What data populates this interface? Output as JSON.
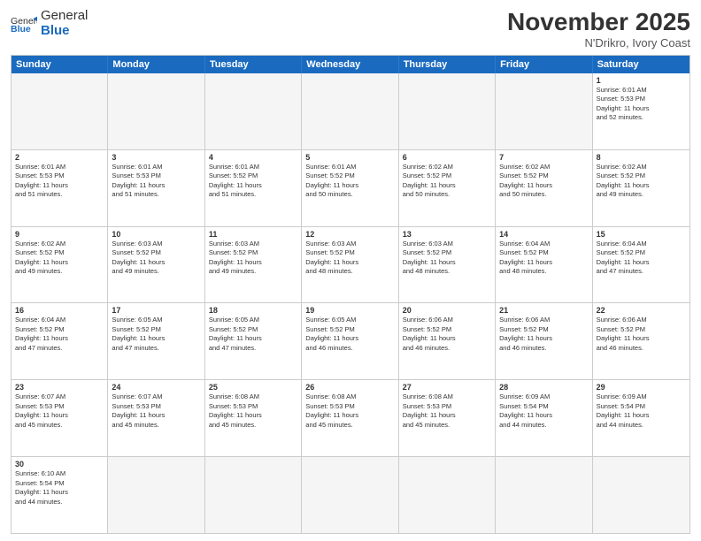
{
  "header": {
    "logo_general": "General",
    "logo_blue": "Blue",
    "month_title": "November 2025",
    "location": "N'Drikro, Ivory Coast"
  },
  "day_headers": [
    "Sunday",
    "Monday",
    "Tuesday",
    "Wednesday",
    "Thursday",
    "Friday",
    "Saturday"
  ],
  "weeks": [
    {
      "days": [
        {
          "num": "",
          "info": "",
          "empty": true
        },
        {
          "num": "",
          "info": "",
          "empty": true
        },
        {
          "num": "",
          "info": "",
          "empty": true
        },
        {
          "num": "",
          "info": "",
          "empty": true
        },
        {
          "num": "",
          "info": "",
          "empty": true
        },
        {
          "num": "",
          "info": "",
          "empty": true
        },
        {
          "num": "1",
          "info": "Sunrise: 6:01 AM\nSunset: 5:53 PM\nDaylight: 11 hours\nand 52 minutes.",
          "empty": false
        }
      ]
    },
    {
      "days": [
        {
          "num": "2",
          "info": "Sunrise: 6:01 AM\nSunset: 5:53 PM\nDaylight: 11 hours\nand 51 minutes.",
          "empty": false
        },
        {
          "num": "3",
          "info": "Sunrise: 6:01 AM\nSunset: 5:53 PM\nDaylight: 11 hours\nand 51 minutes.",
          "empty": false
        },
        {
          "num": "4",
          "info": "Sunrise: 6:01 AM\nSunset: 5:52 PM\nDaylight: 11 hours\nand 51 minutes.",
          "empty": false
        },
        {
          "num": "5",
          "info": "Sunrise: 6:01 AM\nSunset: 5:52 PM\nDaylight: 11 hours\nand 50 minutes.",
          "empty": false
        },
        {
          "num": "6",
          "info": "Sunrise: 6:02 AM\nSunset: 5:52 PM\nDaylight: 11 hours\nand 50 minutes.",
          "empty": false
        },
        {
          "num": "7",
          "info": "Sunrise: 6:02 AM\nSunset: 5:52 PM\nDaylight: 11 hours\nand 50 minutes.",
          "empty": false
        },
        {
          "num": "8",
          "info": "Sunrise: 6:02 AM\nSunset: 5:52 PM\nDaylight: 11 hours\nand 49 minutes.",
          "empty": false
        }
      ]
    },
    {
      "days": [
        {
          "num": "9",
          "info": "Sunrise: 6:02 AM\nSunset: 5:52 PM\nDaylight: 11 hours\nand 49 minutes.",
          "empty": false
        },
        {
          "num": "10",
          "info": "Sunrise: 6:03 AM\nSunset: 5:52 PM\nDaylight: 11 hours\nand 49 minutes.",
          "empty": false
        },
        {
          "num": "11",
          "info": "Sunrise: 6:03 AM\nSunset: 5:52 PM\nDaylight: 11 hours\nand 49 minutes.",
          "empty": false
        },
        {
          "num": "12",
          "info": "Sunrise: 6:03 AM\nSunset: 5:52 PM\nDaylight: 11 hours\nand 48 minutes.",
          "empty": false
        },
        {
          "num": "13",
          "info": "Sunrise: 6:03 AM\nSunset: 5:52 PM\nDaylight: 11 hours\nand 48 minutes.",
          "empty": false
        },
        {
          "num": "14",
          "info": "Sunrise: 6:04 AM\nSunset: 5:52 PM\nDaylight: 11 hours\nand 48 minutes.",
          "empty": false
        },
        {
          "num": "15",
          "info": "Sunrise: 6:04 AM\nSunset: 5:52 PM\nDaylight: 11 hours\nand 47 minutes.",
          "empty": false
        }
      ]
    },
    {
      "days": [
        {
          "num": "16",
          "info": "Sunrise: 6:04 AM\nSunset: 5:52 PM\nDaylight: 11 hours\nand 47 minutes.",
          "empty": false
        },
        {
          "num": "17",
          "info": "Sunrise: 6:05 AM\nSunset: 5:52 PM\nDaylight: 11 hours\nand 47 minutes.",
          "empty": false
        },
        {
          "num": "18",
          "info": "Sunrise: 6:05 AM\nSunset: 5:52 PM\nDaylight: 11 hours\nand 47 minutes.",
          "empty": false
        },
        {
          "num": "19",
          "info": "Sunrise: 6:05 AM\nSunset: 5:52 PM\nDaylight: 11 hours\nand 46 minutes.",
          "empty": false
        },
        {
          "num": "20",
          "info": "Sunrise: 6:06 AM\nSunset: 5:52 PM\nDaylight: 11 hours\nand 46 minutes.",
          "empty": false
        },
        {
          "num": "21",
          "info": "Sunrise: 6:06 AM\nSunset: 5:52 PM\nDaylight: 11 hours\nand 46 minutes.",
          "empty": false
        },
        {
          "num": "22",
          "info": "Sunrise: 6:06 AM\nSunset: 5:52 PM\nDaylight: 11 hours\nand 46 minutes.",
          "empty": false
        }
      ]
    },
    {
      "days": [
        {
          "num": "23",
          "info": "Sunrise: 6:07 AM\nSunset: 5:53 PM\nDaylight: 11 hours\nand 45 minutes.",
          "empty": false
        },
        {
          "num": "24",
          "info": "Sunrise: 6:07 AM\nSunset: 5:53 PM\nDaylight: 11 hours\nand 45 minutes.",
          "empty": false
        },
        {
          "num": "25",
          "info": "Sunrise: 6:08 AM\nSunset: 5:53 PM\nDaylight: 11 hours\nand 45 minutes.",
          "empty": false
        },
        {
          "num": "26",
          "info": "Sunrise: 6:08 AM\nSunset: 5:53 PM\nDaylight: 11 hours\nand 45 minutes.",
          "empty": false
        },
        {
          "num": "27",
          "info": "Sunrise: 6:08 AM\nSunset: 5:53 PM\nDaylight: 11 hours\nand 45 minutes.",
          "empty": false
        },
        {
          "num": "28",
          "info": "Sunrise: 6:09 AM\nSunset: 5:54 PM\nDaylight: 11 hours\nand 44 minutes.",
          "empty": false
        },
        {
          "num": "29",
          "info": "Sunrise: 6:09 AM\nSunset: 5:54 PM\nDaylight: 11 hours\nand 44 minutes.",
          "empty": false
        }
      ]
    },
    {
      "days": [
        {
          "num": "30",
          "info": "Sunrise: 6:10 AM\nSunset: 5:54 PM\nDaylight: 11 hours\nand 44 minutes.",
          "empty": false
        },
        {
          "num": "",
          "info": "",
          "empty": true
        },
        {
          "num": "",
          "info": "",
          "empty": true
        },
        {
          "num": "",
          "info": "",
          "empty": true
        },
        {
          "num": "",
          "info": "",
          "empty": true
        },
        {
          "num": "",
          "info": "",
          "empty": true
        },
        {
          "num": "",
          "info": "",
          "empty": true
        }
      ]
    }
  ]
}
